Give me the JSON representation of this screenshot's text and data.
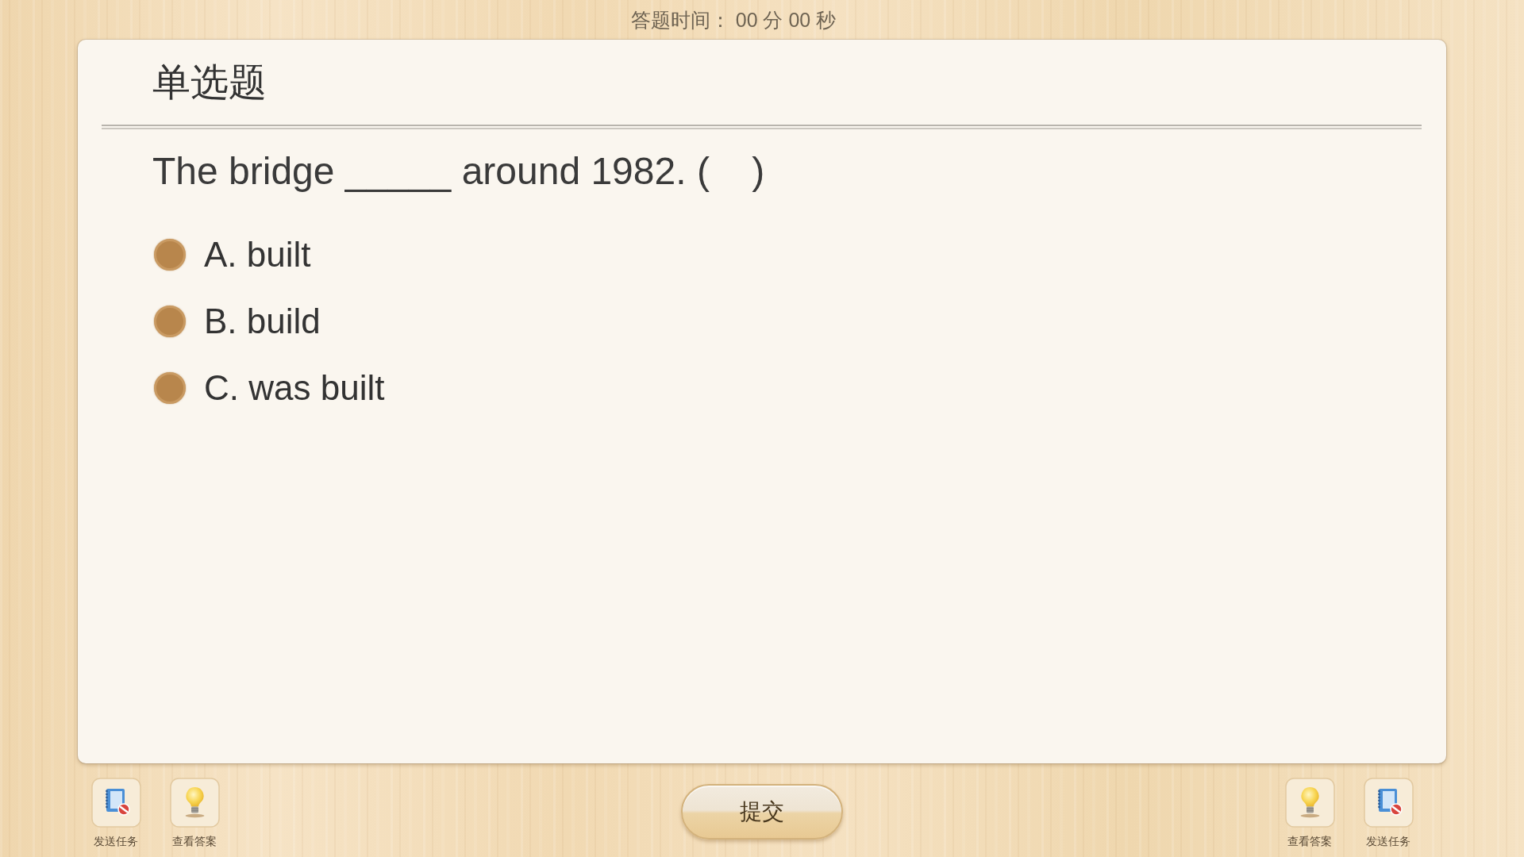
{
  "timer": "答题时间： 00 分 00 秒",
  "question": {
    "type_title": "单选题",
    "text": "The bridge _____ around 1982. (    )",
    "options": [
      {
        "label": "A. built",
        "selected": false
      },
      {
        "label": "B. build",
        "selected": false
      },
      {
        "label": "C. was built",
        "selected": false
      }
    ]
  },
  "toolbar_left": [
    {
      "kind": "send_task",
      "label": "发送任务"
    },
    {
      "kind": "view_answer",
      "label": "查看答案"
    }
  ],
  "submit_button": "提交",
  "toolbar_right": [
    {
      "kind": "view_answer",
      "label": "查看答案"
    },
    {
      "kind": "send_task",
      "label": "发送任务"
    }
  ]
}
